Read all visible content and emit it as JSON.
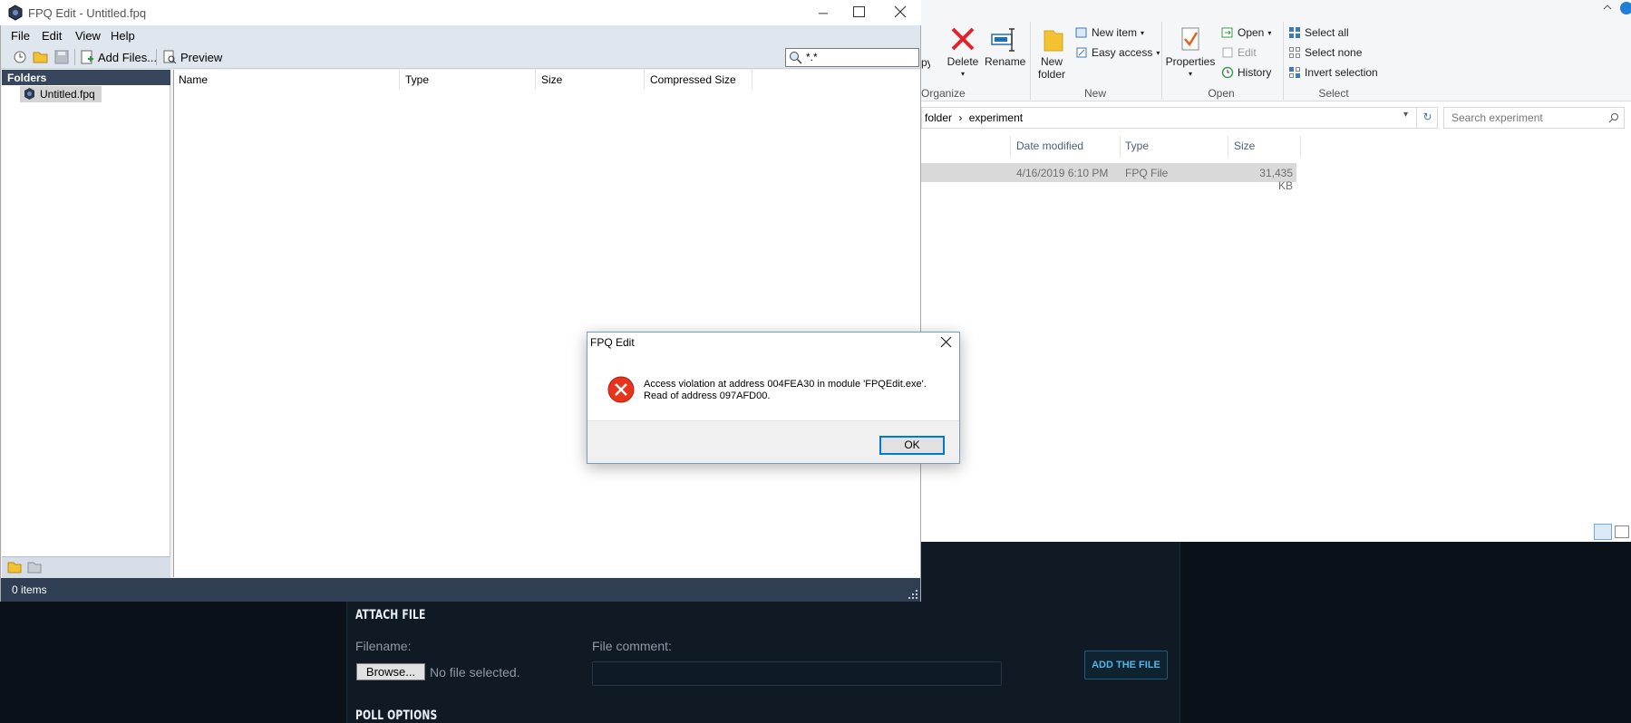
{
  "webpage": {
    "attach_heading": "ATTACH FILE",
    "filename_label": "Filename:",
    "browse_label": "Browse...",
    "no_file_text": "No file selected.",
    "comment_label": "File comment:",
    "add_file_label": "ADD THE FILE",
    "poll_heading": "POLL OPTIONS"
  },
  "explorer": {
    "ribbon": {
      "copy_partial": "py",
      "delete": "Delete",
      "rename": "Rename",
      "organize": "Organize",
      "new_folder": "New folder",
      "new_item": "New item",
      "easy_access": "Easy access",
      "new_group": "New",
      "properties": "Properties",
      "open": "Open",
      "edit": "Edit",
      "history": "History",
      "open_group": "Open",
      "select_all": "Select all",
      "select_none": "Select none",
      "invert_selection": "Invert selection",
      "select_group": "Select"
    },
    "address": {
      "crumb1": "folder",
      "crumb2": "experiment"
    },
    "search_placeholder": "Search experiment",
    "columns": {
      "date": "Date modified",
      "type": "Type",
      "size": "Size"
    },
    "row": {
      "date": "4/16/2019 6:10 PM",
      "type": "FPQ File",
      "size": "31,435 KB"
    }
  },
  "fpq": {
    "title": "FPQ Edit - Untitled.fpq",
    "menu": [
      "File",
      "Edit",
      "View",
      "Help"
    ],
    "toolbar": {
      "add_files": "Add Files...",
      "preview": "Preview"
    },
    "filter_value": "*.*",
    "folders_header": "Folders",
    "tree_item": "Untitled.fpq",
    "columns": [
      "Name",
      "Type",
      "Size",
      "Compressed Size"
    ],
    "status": "0 items"
  },
  "dialog": {
    "title": "FPQ Edit",
    "message_line1": "Access violation at address 004FEA30 in module 'FPQEdit.exe'.",
    "message_line2": "Read of address 097AFD00.",
    "ok_label": "OK"
  }
}
